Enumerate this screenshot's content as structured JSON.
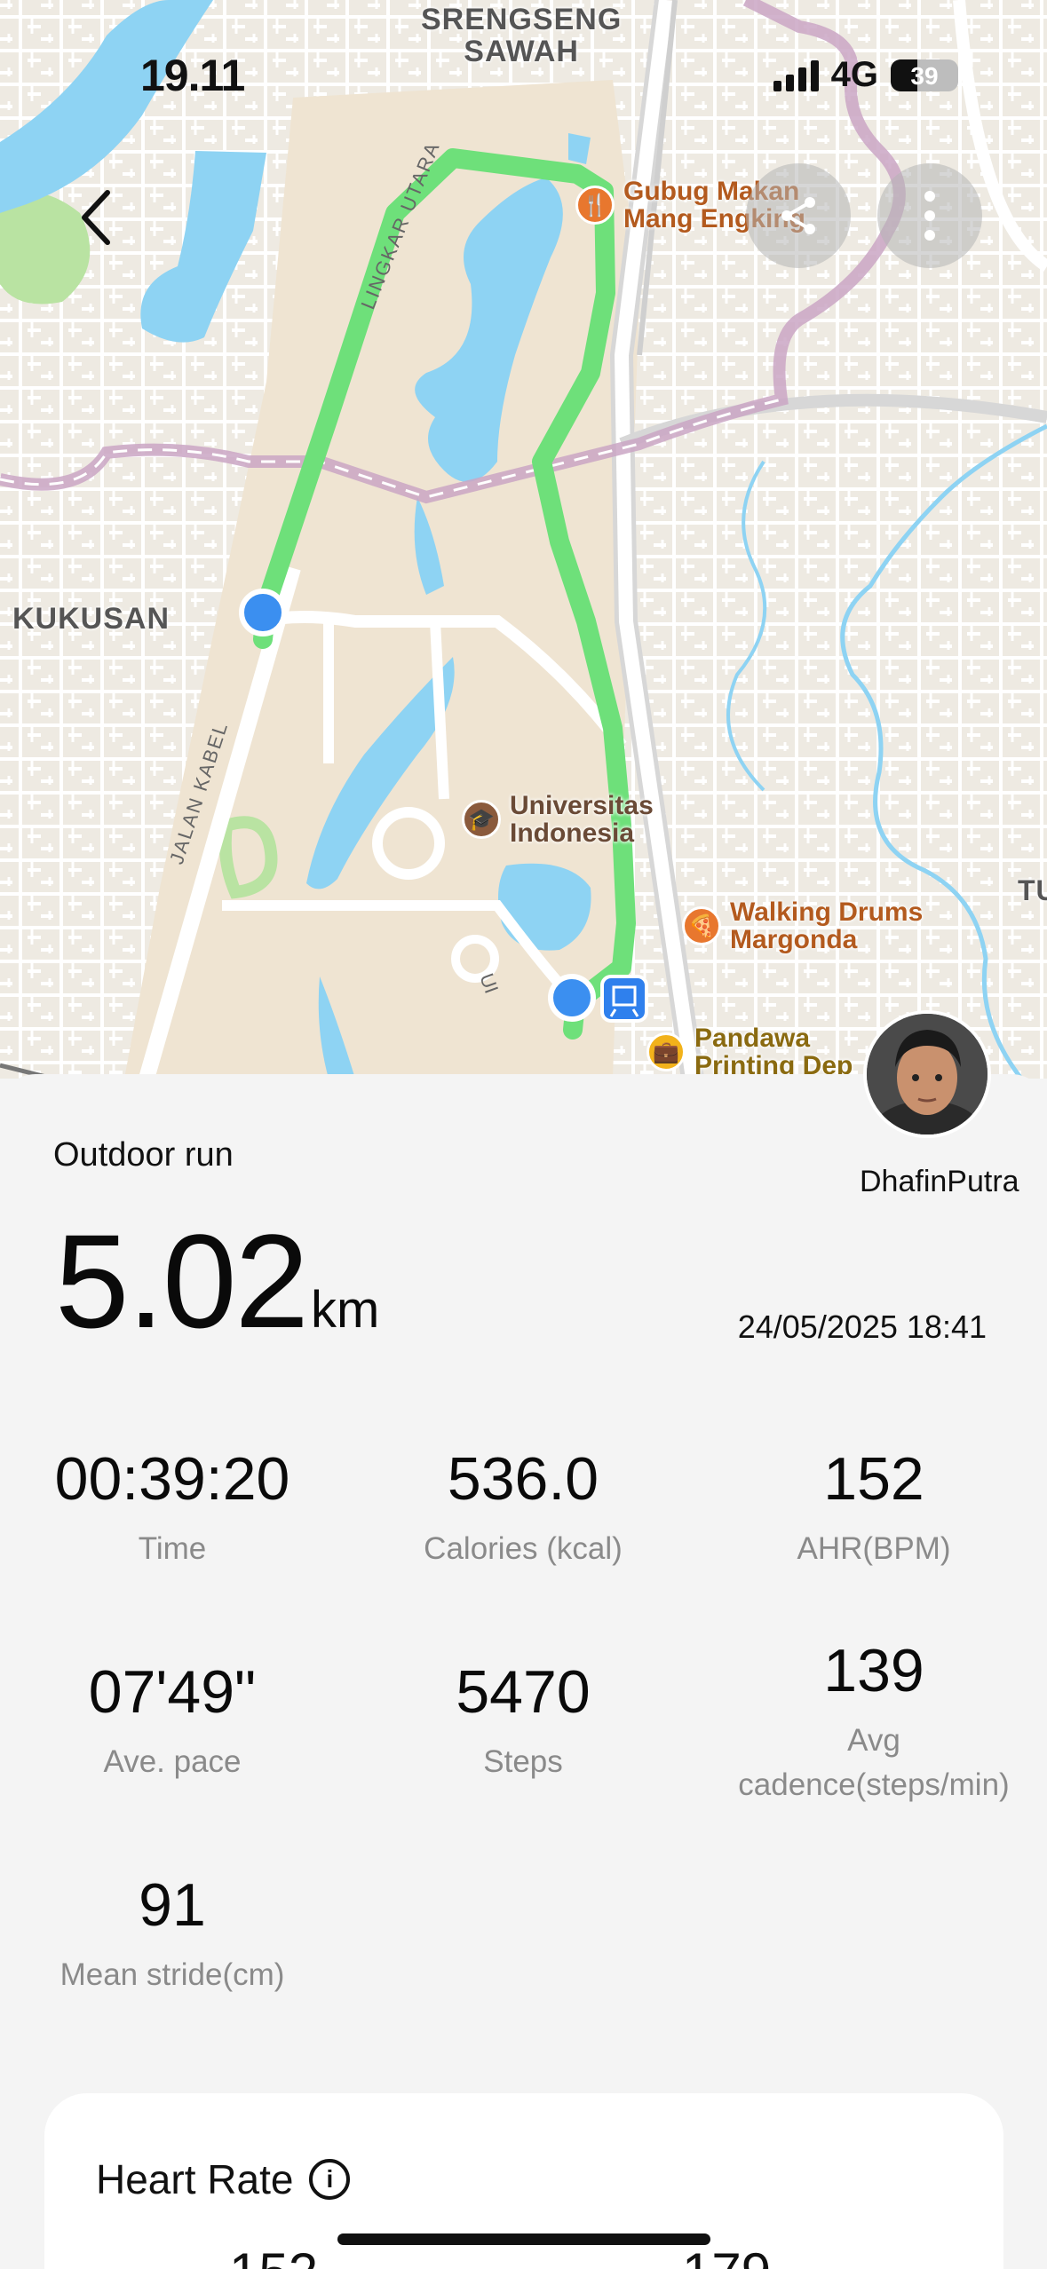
{
  "status_bar": {
    "time": "19.11",
    "network": "4G",
    "battery": "39",
    "battery_level": 0.39
  },
  "map": {
    "area_labels": {
      "srengseng_line1": "SRENGSENG",
      "srengseng_line2": "SAWAH",
      "kukusan": "KUKUSAN",
      "tu": "TU"
    },
    "road_labels": {
      "lingkar_utara": "LINGKAR UTARA",
      "jalan_kabel": "JALAN KABEL",
      "ui": "UI"
    },
    "pois": [
      {
        "line1": "Gubug Makan",
        "line2": "Mang Engking",
        "color": "#e8772e",
        "icon": "restaurant-icon"
      },
      {
        "line1": "Universitas",
        "line2": "Indonesia",
        "color": "#8a5a3c",
        "icon": "graduation-cap-icon"
      },
      {
        "line1": "Walking Drums",
        "line2": "Margonda",
        "color": "#e8772e",
        "icon": "pizza-icon"
      },
      {
        "line1": "Pandawa",
        "line2": "Printing Dep",
        "color": "#f2b21a",
        "icon": "briefcase-icon"
      }
    ],
    "route_color": "#6ee07a",
    "marker_color": "#3b8ff0"
  },
  "workout": {
    "type": "Outdoor run",
    "distance": "5.02",
    "distance_unit": "km",
    "user": "DhafinPutra",
    "datetime": "24/05/2025 18:41",
    "stats": {
      "time": {
        "value": "00:39:20",
        "label": "Time"
      },
      "calories": {
        "value": "536.0",
        "label": "Calories (kcal)"
      },
      "ahr": {
        "value": "152",
        "label": "AHR(BPM)"
      },
      "pace": {
        "value": "07'49\"",
        "label": "Ave. pace"
      },
      "steps": {
        "value": "5470",
        "label": "Steps"
      },
      "cadence": {
        "value": "139",
        "label": "Avg cadence(steps/min)"
      },
      "stride": {
        "value": "91",
        "label": "Mean stride(cm)"
      }
    }
  },
  "heart_rate": {
    "title": "Heart Rate",
    "left_value": "152",
    "right_value": "179"
  }
}
